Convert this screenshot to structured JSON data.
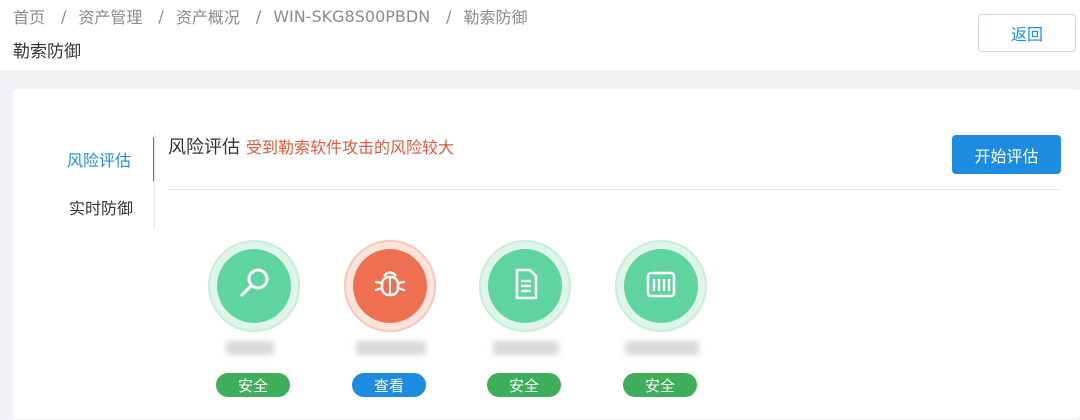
{
  "breadcrumb": {
    "items": [
      "首页",
      "资产管理",
      "资产概况",
      "WIN-SKG8S00PBDN",
      "勒索防御"
    ],
    "separator": "/"
  },
  "header": {
    "title": "勒索防御",
    "back_label": "返回"
  },
  "side_menu": {
    "items": [
      {
        "label": "风险评估",
        "active": true
      },
      {
        "label": "实时防御",
        "active": false
      }
    ]
  },
  "section": {
    "title": "风险评估",
    "risk_message": "受到勒索软件攻击的风险较大",
    "start_label": "开始评估"
  },
  "checks": [
    {
      "icon": "search-icon",
      "color": "#5fd3a0",
      "status": "安全"
    },
    {
      "icon": "bug-icon",
      "color": "#ef7050",
      "status": "查看"
    },
    {
      "icon": "file-icon",
      "color": "#5fd3a0",
      "status": "安全"
    },
    {
      "icon": "network-port-icon",
      "color": "#5fd3a0",
      "status": "安全"
    }
  ],
  "colors": {
    "accent": "#1d8ce0",
    "safe": "#3fae5a",
    "danger": "#ef7050",
    "risk_text": "#e0573a"
  }
}
